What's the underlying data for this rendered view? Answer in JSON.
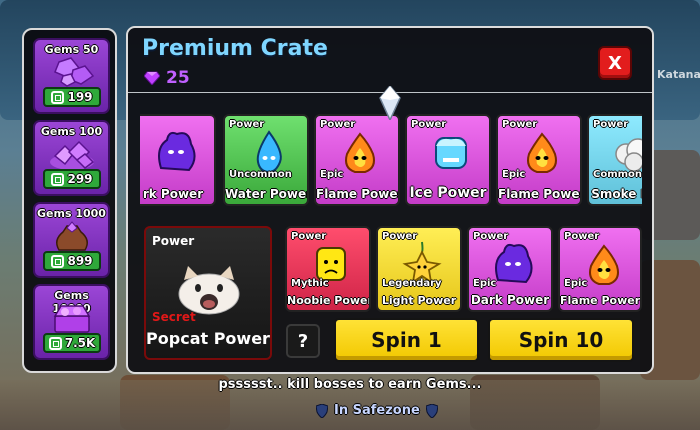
{
  "npc_label": "Katana",
  "shop": {
    "items": [
      {
        "label": "Gems 50",
        "price": "199"
      },
      {
        "label": "Gems 100",
        "price": "299"
      },
      {
        "label": "Gems 1000",
        "price": "899"
      },
      {
        "label": "Gems 10000",
        "price": "7.5K"
      }
    ]
  },
  "crate": {
    "title": "Premium Crate",
    "cost": "25",
    "close_label": "X",
    "reel": [
      {
        "type": "",
        "rarity": "",
        "name": "rk Power",
        "color": "#e05cf0",
        "icon": "purple-fruit-icon"
      },
      {
        "type": "Power",
        "rarity": "Uncommon",
        "name": "Water Power",
        "color": "#55d455",
        "icon": "water-drop-fruit-icon"
      },
      {
        "type": "Power",
        "rarity": "Epic",
        "name": "Flame Power",
        "color": "#e05cf0",
        "icon": "flame-fruit-icon"
      },
      {
        "type": "Power",
        "rarity": "",
        "name": "Ice Power",
        "color": "#e05cf0",
        "icon": "ice-fruit-icon"
      },
      {
        "type": "Power",
        "rarity": "Epic",
        "name": "Flame Power",
        "color": "#e05cf0",
        "icon": "flame-fruit-icon"
      },
      {
        "type": "Power",
        "rarity": "Common",
        "name": "Smoke Pow",
        "color": "#7fdcf0",
        "icon": "smoke-fruit-icon"
      }
    ],
    "featured": {
      "type": "Power",
      "rarity": "Secret",
      "name": "Popcat Power",
      "icon": "popcat-icon"
    },
    "pool": [
      {
        "type": "Power",
        "rarity": "Mythic",
        "name": "Noobie Power",
        "color": "#ff4d6d",
        "icon": "noobie-head-icon"
      },
      {
        "type": "Power",
        "rarity": "Legendary",
        "name": "Light Power",
        "color": "#ffe844",
        "icon": "light-fruit-icon"
      },
      {
        "type": "Power",
        "rarity": "Epic",
        "name": "Dark Power",
        "color": "#e05cf0",
        "icon": "purple-fruit-icon"
      },
      {
        "type": "Power",
        "rarity": "Epic",
        "name": "Flame Power",
        "color": "#e05cf0",
        "icon": "flame-fruit-icon"
      }
    ],
    "help_label": "?",
    "spin1_label": "Spin 1",
    "spin10_label": "Spin 10"
  },
  "tip": "pssssst.. kill bosses to earn Gems...",
  "zone": "In Safezone"
}
